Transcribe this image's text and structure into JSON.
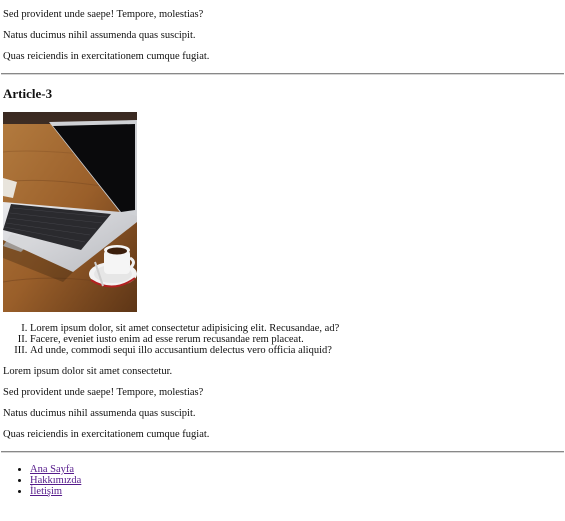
{
  "top_paragraphs": [
    "Sed provident unde saepe! Tempore, molestias?",
    "Natus ducimus nihil assumenda quas suscipit.",
    "Quas reiciendis in exercitationem cumque fugiat."
  ],
  "article": {
    "title": "Article-3",
    "image_icon": "laptop-photo",
    "list_items": [
      "Lorem ipsum dolor, sit amet consectetur adipisicing elit. Recusandae, ad?",
      "Facere, eveniet iusto enim ad esse rerum recusandae rem placeat.",
      "Ad unde, commodi sequi illo accusantium delectus vero officia aliquid?"
    ],
    "paragraphs": [
      "Lorem ipsum dolor sit amet consectetur.",
      "Sed provident unde saepe! Tempore, molestias?",
      "Natus ducimus nihil assumenda quas suscipit.",
      "Quas reiciendis in exercitationem cumque fugiat."
    ]
  },
  "footer_nav": [
    "Ana Sayfa",
    "Hakkımızda",
    "İletişim"
  ],
  "colors": {
    "link": "#551a8b",
    "text": "#111111"
  }
}
